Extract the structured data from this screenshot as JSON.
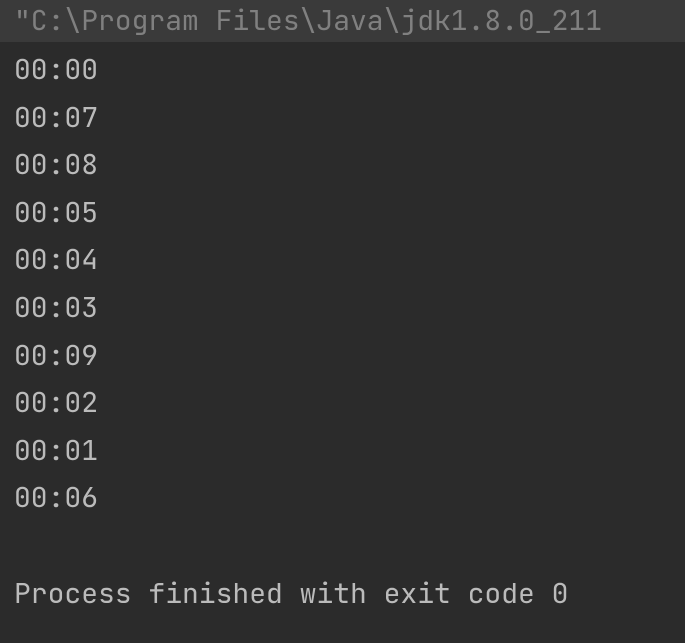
{
  "console": {
    "command": "\"C:\\Program Files\\Java\\jdk1.8.0_211",
    "output": [
      "00:00",
      "00:07",
      "00:08",
      "00:05",
      "00:04",
      "00:03",
      "00:09",
      "00:02",
      "00:01",
      "00:06"
    ],
    "exit_message": "Process finished with exit code 0"
  }
}
